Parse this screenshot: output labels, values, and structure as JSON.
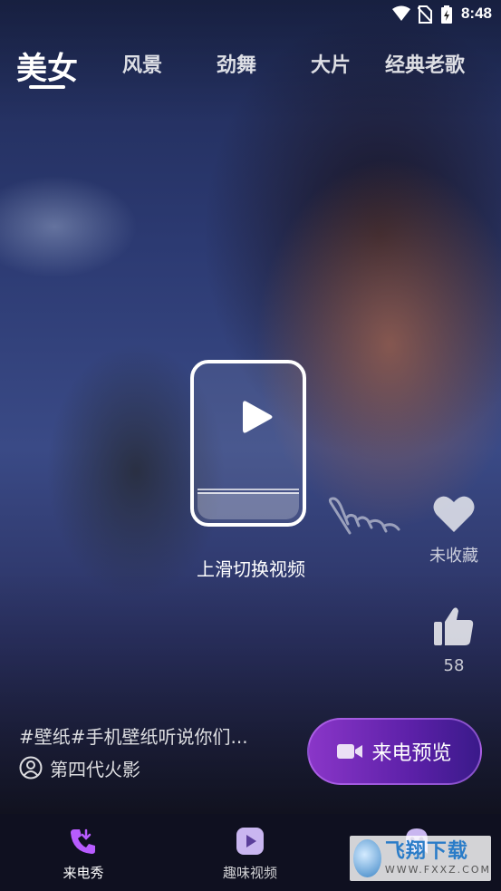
{
  "status_bar": {
    "time": "8:48"
  },
  "tabs": [
    {
      "label": "美女",
      "active": true
    },
    {
      "label": "风景"
    },
    {
      "label": "劲舞"
    },
    {
      "label": "大片"
    },
    {
      "label": "经典老歌"
    }
  ],
  "swipe_hint": {
    "text": "上滑切换视频"
  },
  "actions": {
    "favorite_label": "未收藏",
    "like_count": "58"
  },
  "video": {
    "description": "#壁纸#手机壁纸听说你们...",
    "author": "第四代火影"
  },
  "preview_button": {
    "label": "来电预览"
  },
  "bottom_nav": [
    {
      "label": "来电秀",
      "icon": "phone-icon",
      "active": true
    },
    {
      "label": "趣味视频",
      "icon": "play-square-icon"
    },
    {
      "label": "",
      "icon": "ghost-icon"
    }
  ],
  "watermark": {
    "cn": "飞翔下载",
    "en": "WWW.FXXZ.COM"
  },
  "colors": {
    "accent": "#8a36c8",
    "nav_bg": "#0f1020"
  }
}
